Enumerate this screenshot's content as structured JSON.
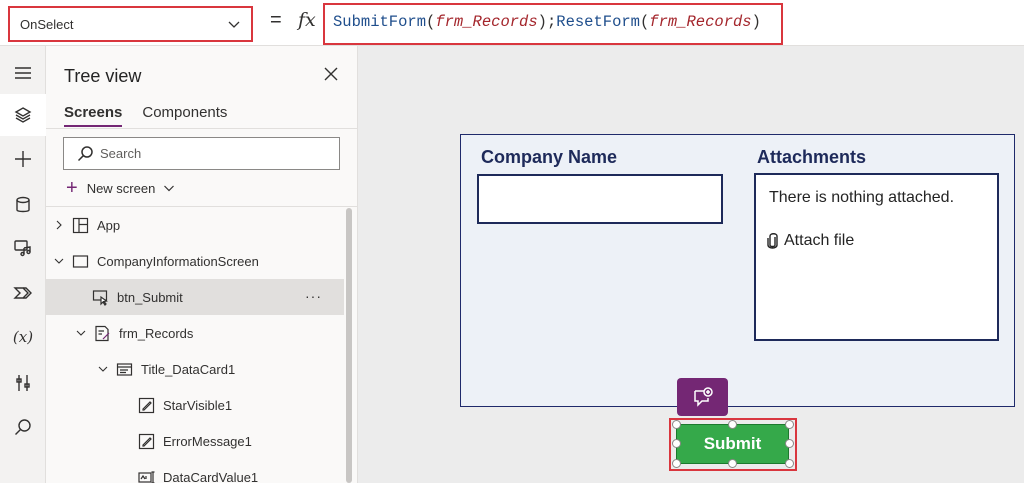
{
  "formula_bar": {
    "property": "OnSelect",
    "equals": "=",
    "fx": "fx",
    "formula": {
      "fn1": "SubmitForm",
      "arg1": "frm_Records",
      "fn2": "ResetForm",
      "arg2": "frm_Records"
    }
  },
  "rail": {
    "icons": [
      "hamburger-icon",
      "layers-icon",
      "plus-icon",
      "database-icon",
      "media-icon",
      "power-automate-icon",
      "variables-icon",
      "tools-icon",
      "search-icon"
    ],
    "variables_label": "(x)"
  },
  "tree_view": {
    "title": "Tree view",
    "tabs": [
      {
        "label": "Screens",
        "active": true
      },
      {
        "label": "Components",
        "active": false
      }
    ],
    "search_placeholder": "Search",
    "new_screen_label": "New screen",
    "nodes": [
      {
        "label": "App"
      },
      {
        "label": "CompanyInformationScreen"
      },
      {
        "label": "btn_Submit",
        "more": "···"
      },
      {
        "label": "frm_Records"
      },
      {
        "label": "Title_DataCard1"
      },
      {
        "label": "StarVisible1"
      },
      {
        "label": "ErrorMessage1"
      },
      {
        "label": "DataCardValue1"
      }
    ]
  },
  "canvas": {
    "form": {
      "company_label": "Company Name",
      "attachments_label": "Attachments",
      "attachments_empty": "There is nothing attached.",
      "attach_file_label": "Attach file"
    },
    "submit_label": "Submit"
  },
  "colors": {
    "accent": "#742774",
    "highlight": "#d9363e",
    "submit_green": "#35a94a",
    "form_border": "#1e2a5a"
  }
}
